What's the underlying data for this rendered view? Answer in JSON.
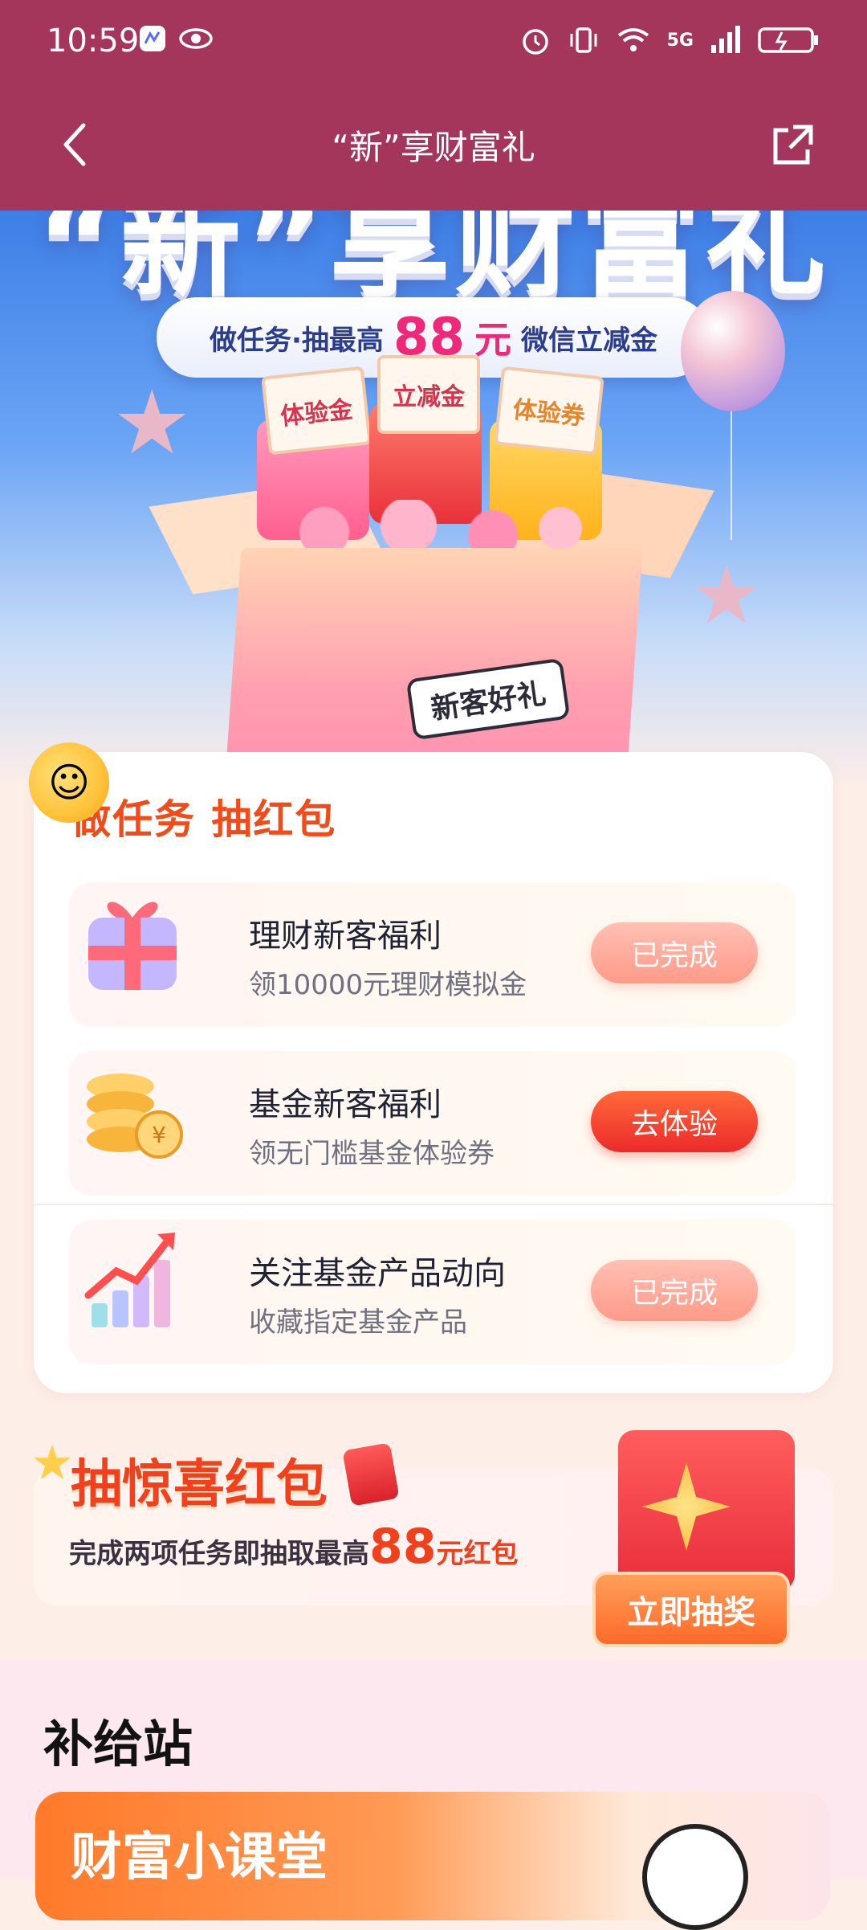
{
  "status_bar": {
    "time": "10:59",
    "network": "5G"
  },
  "nav": {
    "title": "“新”享财富礼"
  },
  "hero": {
    "title": "“新”享财富礼",
    "pill_prefix": "做任务·抽最高",
    "pill_amount": "88",
    "pill_unit": "元",
    "pill_suffix": "微信立减金",
    "packets": [
      "体验金",
      "立减金",
      "体验券"
    ],
    "box_badge": "新客好礼"
  },
  "tasks": {
    "heading": "做任务 抽红包",
    "items": [
      {
        "title": "理财新客福利",
        "subtitle": "领10000元理财模拟金",
        "button": "已完成",
        "state": "done"
      },
      {
        "title": "基金新客福利",
        "subtitle": "领无门槛基金体验券",
        "button": "去体验",
        "state": "todo"
      },
      {
        "title": "关注基金产品动向",
        "subtitle": "收藏指定基金产品",
        "button": "已完成",
        "state": "done"
      }
    ]
  },
  "surprise": {
    "title": "抽惊喜红包",
    "desc_prefix": "完成两项任务即抽取最高",
    "amount": "88",
    "desc_suffix": "元红包",
    "button": "立即抽奖"
  },
  "supply": {
    "title": "补给站",
    "card_title": "财富小课堂"
  },
  "colors": {
    "topbar": "#a3365a",
    "accent_orange": "#f04b18",
    "hero_pink": "#f0287a"
  }
}
